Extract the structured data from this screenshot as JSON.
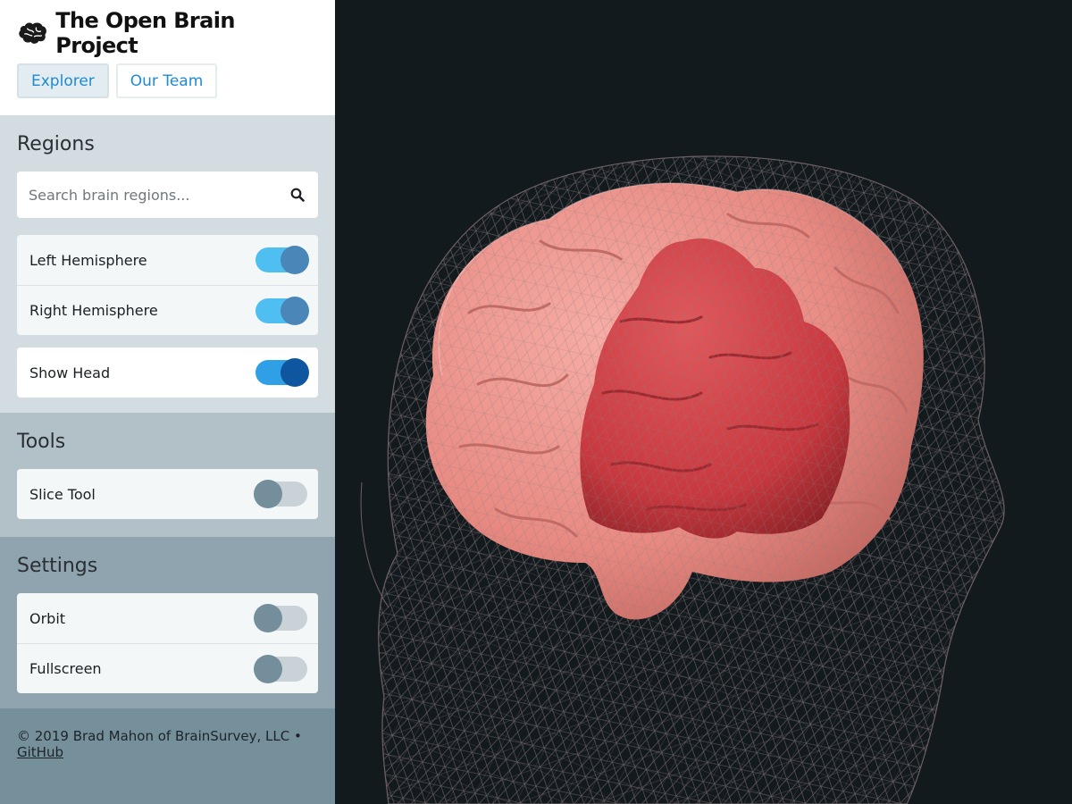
{
  "app": {
    "title": "The Open Brain Project",
    "nav": [
      {
        "label": "Explorer",
        "active": true
      },
      {
        "label": "Our Team",
        "active": false
      }
    ]
  },
  "regions": {
    "heading": "Regions",
    "search_placeholder": "Search brain regions...",
    "search_value": "",
    "hemispheres": [
      {
        "label": "Left Hemisphere",
        "on": true
      },
      {
        "label": "Right Hemisphere",
        "on": true
      }
    ],
    "show_head": {
      "label": "Show Head",
      "on": true
    }
  },
  "tools": {
    "heading": "Tools",
    "items": [
      {
        "label": "Slice Tool",
        "on": false
      }
    ]
  },
  "settings": {
    "heading": "Settings",
    "items": [
      {
        "label": "Orbit",
        "on": false
      },
      {
        "label": "Fullscreen",
        "on": false
      }
    ]
  },
  "footer": {
    "text": "© 2019 Brad Mahon of BrainSurvey, LLC •",
    "link": "GitHub"
  },
  "colors": {
    "accent": "#1e8bd1",
    "viewer_bg": "#131a1e",
    "brain": "#e88a82",
    "highlight_region": "#c8393f",
    "wireframe": "#8a7a7f"
  }
}
